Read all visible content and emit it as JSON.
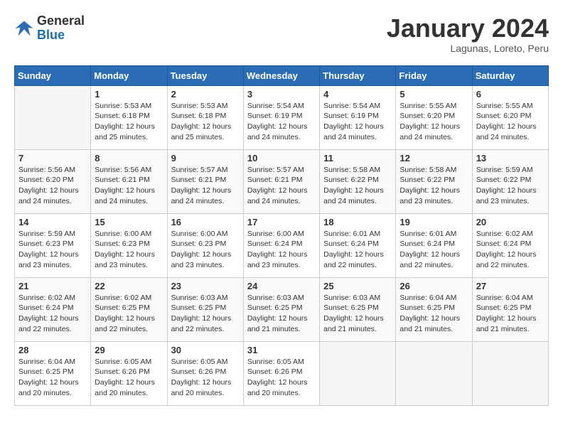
{
  "logo": {
    "general": "General",
    "blue": "Blue"
  },
  "header": {
    "title": "January 2024",
    "subtitle": "Lagunas, Loreto, Peru"
  },
  "weekdays": [
    "Sunday",
    "Monday",
    "Tuesday",
    "Wednesday",
    "Thursday",
    "Friday",
    "Saturday"
  ],
  "weeks": [
    [
      {
        "day": "",
        "info": ""
      },
      {
        "day": "1",
        "info": "Sunrise: 5:53 AM\nSunset: 6:18 PM\nDaylight: 12 hours\nand 25 minutes."
      },
      {
        "day": "2",
        "info": "Sunrise: 5:53 AM\nSunset: 6:18 PM\nDaylight: 12 hours\nand 25 minutes."
      },
      {
        "day": "3",
        "info": "Sunrise: 5:54 AM\nSunset: 6:19 PM\nDaylight: 12 hours\nand 24 minutes."
      },
      {
        "day": "4",
        "info": "Sunrise: 5:54 AM\nSunset: 6:19 PM\nDaylight: 12 hours\nand 24 minutes."
      },
      {
        "day": "5",
        "info": "Sunrise: 5:55 AM\nSunset: 6:20 PM\nDaylight: 12 hours\nand 24 minutes."
      },
      {
        "day": "6",
        "info": "Sunrise: 5:55 AM\nSunset: 6:20 PM\nDaylight: 12 hours\nand 24 minutes."
      }
    ],
    [
      {
        "day": "7",
        "info": "Sunrise: 5:56 AM\nSunset: 6:20 PM\nDaylight: 12 hours\nand 24 minutes."
      },
      {
        "day": "8",
        "info": "Sunrise: 5:56 AM\nSunset: 6:21 PM\nDaylight: 12 hours\nand 24 minutes."
      },
      {
        "day": "9",
        "info": "Sunrise: 5:57 AM\nSunset: 6:21 PM\nDaylight: 12 hours\nand 24 minutes."
      },
      {
        "day": "10",
        "info": "Sunrise: 5:57 AM\nSunset: 6:21 PM\nDaylight: 12 hours\nand 24 minutes."
      },
      {
        "day": "11",
        "info": "Sunrise: 5:58 AM\nSunset: 6:22 PM\nDaylight: 12 hours\nand 24 minutes."
      },
      {
        "day": "12",
        "info": "Sunrise: 5:58 AM\nSunset: 6:22 PM\nDaylight: 12 hours\nand 23 minutes."
      },
      {
        "day": "13",
        "info": "Sunrise: 5:59 AM\nSunset: 6:22 PM\nDaylight: 12 hours\nand 23 minutes."
      }
    ],
    [
      {
        "day": "14",
        "info": "Sunrise: 5:59 AM\nSunset: 6:23 PM\nDaylight: 12 hours\nand 23 minutes."
      },
      {
        "day": "15",
        "info": "Sunrise: 6:00 AM\nSunset: 6:23 PM\nDaylight: 12 hours\nand 23 minutes."
      },
      {
        "day": "16",
        "info": "Sunrise: 6:00 AM\nSunset: 6:23 PM\nDaylight: 12 hours\nand 23 minutes."
      },
      {
        "day": "17",
        "info": "Sunrise: 6:00 AM\nSunset: 6:24 PM\nDaylight: 12 hours\nand 23 minutes."
      },
      {
        "day": "18",
        "info": "Sunrise: 6:01 AM\nSunset: 6:24 PM\nDaylight: 12 hours\nand 22 minutes."
      },
      {
        "day": "19",
        "info": "Sunrise: 6:01 AM\nSunset: 6:24 PM\nDaylight: 12 hours\nand 22 minutes."
      },
      {
        "day": "20",
        "info": "Sunrise: 6:02 AM\nSunset: 6:24 PM\nDaylight: 12 hours\nand 22 minutes."
      }
    ],
    [
      {
        "day": "21",
        "info": "Sunrise: 6:02 AM\nSunset: 6:24 PM\nDaylight: 12 hours\nand 22 minutes."
      },
      {
        "day": "22",
        "info": "Sunrise: 6:02 AM\nSunset: 6:25 PM\nDaylight: 12 hours\nand 22 minutes."
      },
      {
        "day": "23",
        "info": "Sunrise: 6:03 AM\nSunset: 6:25 PM\nDaylight: 12 hours\nand 22 minutes."
      },
      {
        "day": "24",
        "info": "Sunrise: 6:03 AM\nSunset: 6:25 PM\nDaylight: 12 hours\nand 21 minutes."
      },
      {
        "day": "25",
        "info": "Sunrise: 6:03 AM\nSunset: 6:25 PM\nDaylight: 12 hours\nand 21 minutes."
      },
      {
        "day": "26",
        "info": "Sunrise: 6:04 AM\nSunset: 6:25 PM\nDaylight: 12 hours\nand 21 minutes."
      },
      {
        "day": "27",
        "info": "Sunrise: 6:04 AM\nSunset: 6:25 PM\nDaylight: 12 hours\nand 21 minutes."
      }
    ],
    [
      {
        "day": "28",
        "info": "Sunrise: 6:04 AM\nSunset: 6:25 PM\nDaylight: 12 hours\nand 20 minutes."
      },
      {
        "day": "29",
        "info": "Sunrise: 6:05 AM\nSunset: 6:26 PM\nDaylight: 12 hours\nand 20 minutes."
      },
      {
        "day": "30",
        "info": "Sunrise: 6:05 AM\nSunset: 6:26 PM\nDaylight: 12 hours\nand 20 minutes."
      },
      {
        "day": "31",
        "info": "Sunrise: 6:05 AM\nSunset: 6:26 PM\nDaylight: 12 hours\nand 20 minutes."
      },
      {
        "day": "",
        "info": ""
      },
      {
        "day": "",
        "info": ""
      },
      {
        "day": "",
        "info": ""
      }
    ]
  ]
}
